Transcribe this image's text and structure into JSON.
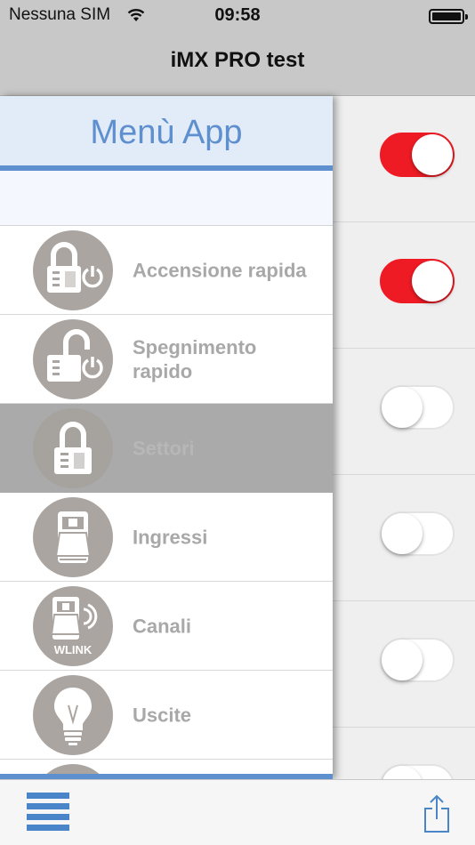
{
  "status_bar": {
    "carrier": "Nessuna SIM",
    "time": "09:58"
  },
  "nav": {
    "title": "iMX PRO test"
  },
  "drawer": {
    "title": "Menù App",
    "items": [
      {
        "label": "Accensione rapida",
        "icon": "lock-power-icon",
        "selected": false
      },
      {
        "label": "Spegnimento rapido",
        "icon": "unlock-power-icon",
        "selected": false
      },
      {
        "label": "Settori",
        "icon": "padlock-icon",
        "selected": true
      },
      {
        "label": "Ingressi",
        "icon": "sensor-device-icon",
        "selected": false
      },
      {
        "label": "Canali",
        "icon": "wlink-device-icon",
        "selected": false
      },
      {
        "label": "Uscite",
        "icon": "lightbulb-icon",
        "selected": false
      }
    ]
  },
  "toggles": [
    {
      "state": "on"
    },
    {
      "state": "on"
    },
    {
      "state": "off"
    },
    {
      "state": "off"
    },
    {
      "state": "off"
    },
    {
      "state": "off"
    }
  ],
  "icons": {
    "wlink_text": "WLINK"
  },
  "colors": {
    "accent_blue": "#5e8fcf",
    "toggle_on": "#ee1b24",
    "icon_circle": "#aba5a1",
    "selected_row": "#aaaaaa"
  },
  "toolbar": {
    "menu_icon": "hamburger-icon",
    "share_icon": "share-icon"
  }
}
